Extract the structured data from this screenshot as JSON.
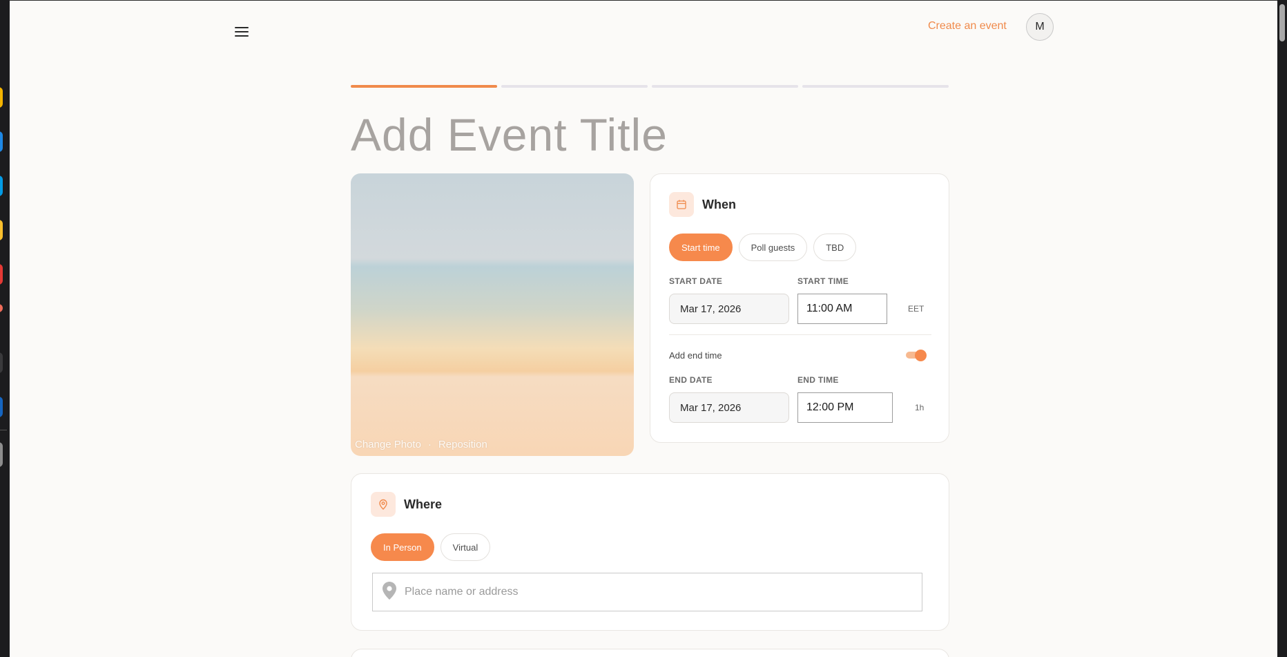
{
  "header": {
    "create_event_label": "Create an event",
    "avatar_initial": "M"
  },
  "progress": {
    "total_steps": 4,
    "current_step": 1
  },
  "event": {
    "title_placeholder": "Add Event Title",
    "photo_actions": {
      "change": "Change Photo",
      "separator": "·",
      "reposition": "Reposition"
    }
  },
  "when": {
    "title": "When",
    "options": [
      "Start time",
      "Poll guests",
      "TBD"
    ],
    "selected_option": "Start time",
    "start_date_label": "START DATE",
    "start_date": "Mar 17, 2026",
    "start_time_label": "START TIME",
    "start_time": "11:00 AM",
    "timezone": "EET",
    "add_end_time_label": "Add end time",
    "add_end_time_enabled": true,
    "end_date_label": "END DATE",
    "end_date": "Mar 17, 2026",
    "end_time_label": "END TIME",
    "end_time": "12:00 PM",
    "duration": "1h"
  },
  "where": {
    "title": "Where",
    "options": [
      "In Person",
      "Virtual"
    ],
    "selected_option": "In Person",
    "address_placeholder": "Place name or address"
  },
  "colors": {
    "accent": "#f6894c",
    "accent_light": "#fde8dd",
    "background": "#fbfaf8"
  }
}
